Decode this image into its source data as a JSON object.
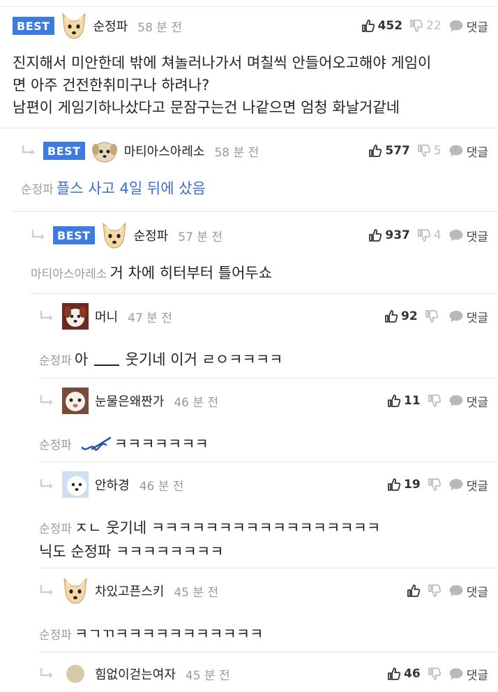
{
  "colors": {
    "badge": "#3d7be0",
    "mention": "#9a9a9a",
    "link_text": "#3d6cc8",
    "divider": "#e3e3e3"
  },
  "icons": {
    "thumbs_up": "thumbs-up-icon",
    "thumbs_down": "thumbs-down-icon",
    "reply": "speech-bubble-icon",
    "reply_arrow": "reply-arrow-icon"
  },
  "comments": [
    {
      "badge": "BEST",
      "nickname": "순정파",
      "time": "58 분 전",
      "likes": "452",
      "dislikes": "22",
      "reply_label": "댓글",
      "mention": "",
      "lines": [
        "진지해서 미안한데 밖에 쳐놀러나가서 며칠씩 안들어오고해야 게임이",
        "면 아주 건전한취미구나 하려나?",
        "남편이 게임기하나샀다고 문잠구는건 나같으면 엄청 화날거같네"
      ]
    },
    {
      "badge": "BEST",
      "nickname": "마티아스아레소",
      "time": "58 분 전",
      "likes": "577",
      "dislikes": "5",
      "reply_label": "댓글",
      "mention": "순정파",
      "lines": [
        "플스 사고 4일 뒤에 샀음"
      ]
    },
    {
      "badge": "BEST",
      "nickname": "순정파",
      "time": "57 분 전",
      "likes": "937",
      "dislikes": "4",
      "reply_label": "댓글",
      "mention": "마티아스아레소",
      "lines": [
        "거 차에 히터부터 틀어두쇼"
      ]
    },
    {
      "badge": "",
      "nickname": "머니",
      "time": "47 분 전",
      "likes": "92",
      "dislikes": "",
      "reply_label": "댓글",
      "mention": "순정파",
      "line_before": "아",
      "line_after": "웃기네 이거 ㄹㅇㅋㅋㅋㅋ"
    },
    {
      "badge": "",
      "nickname": "눈물은왜짠가",
      "time": "46 분 전",
      "likes": "11",
      "dislikes": "",
      "reply_label": "댓글",
      "mention": "순정파",
      "line_after": "ㅋㅋㅋㅋㅋㅋㅋ"
    },
    {
      "badge": "",
      "nickname": "안하경",
      "time": "46 분 전",
      "likes": "19",
      "dislikes": "",
      "reply_label": "댓글",
      "mention": "순정파",
      "lines": [
        "ㅈㄴ 웃기네 ㅋㅋㅋㅋㅋㅋㅋㅋㅋㅋㅋㅋㅋㅋㅋㅋㅋ",
        "닉도 순정파 ㅋㅋㅋㅋㅋㅋㅋㅋ"
      ]
    },
    {
      "badge": "",
      "nickname": "차있고픈스키",
      "time": "45 분 전",
      "likes": "",
      "dislikes": "",
      "reply_label": "댓글",
      "mention": "순정파",
      "lines": [
        "ㅋㄱㄲㅋㅋㅋㅋㅋㅋㅋㅋㅋㅋㅋ"
      ]
    },
    {
      "badge": "",
      "nickname": "힘없이걷는여자",
      "time": "45 분 전",
      "likes": "46",
      "dislikes": "",
      "reply_label": "댓글"
    }
  ]
}
